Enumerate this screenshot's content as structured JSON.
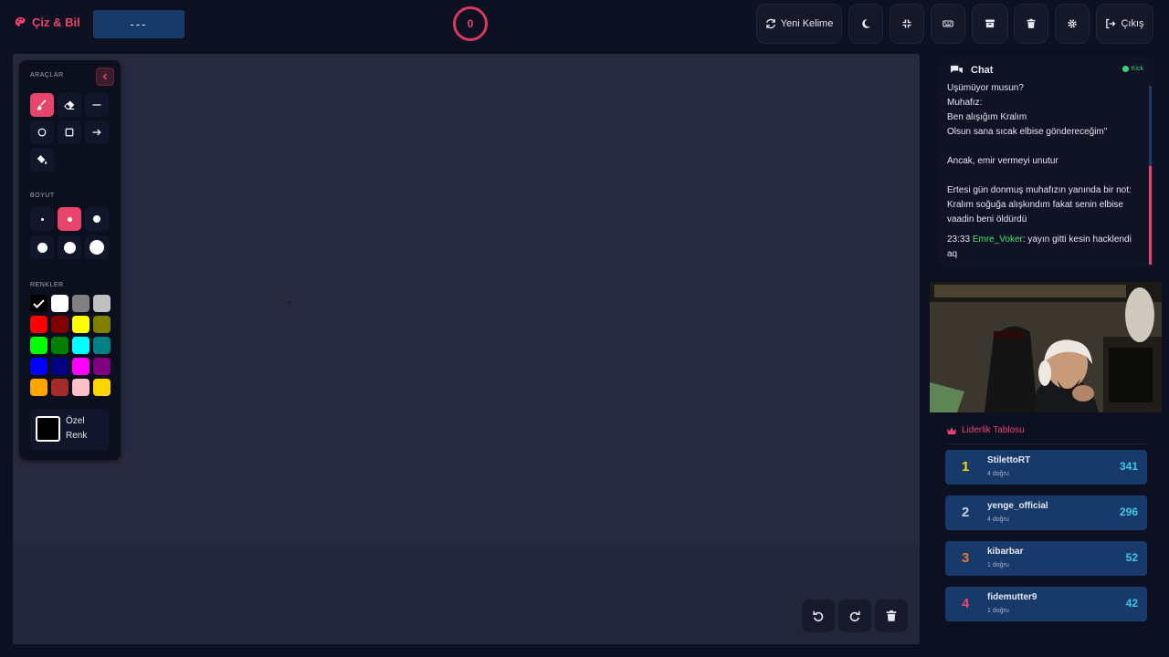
{
  "brand": {
    "name": "Çiz & Bil",
    "icon": "palette-icon",
    "color": "#e8456d"
  },
  "word_hint": "---",
  "timer": {
    "value": "0"
  },
  "toolbar": {
    "new_word_label": "Yeni Kelime",
    "exit_label": "Çıkış",
    "icons": [
      "refresh-icon",
      "moon-icon",
      "compress-icon",
      "keyboard-icon",
      "archive-icon",
      "trash-icon",
      "gear-icon",
      "logout-icon"
    ]
  },
  "tools_panel": {
    "title": "ARAÇLAR",
    "size_title": "BOYUT",
    "colors_title": "RENKLER",
    "tools": [
      "brush",
      "eraser",
      "line",
      "circle",
      "rectangle",
      "arrow",
      "fill"
    ],
    "active_tool": "brush",
    "active_size_index": 1,
    "colors": [
      "#000000",
      "#ffffff",
      "#808080",
      "#c0c0c0",
      "#ff0000",
      "#800000",
      "#ffff00",
      "#808000",
      "#00ff00",
      "#008000",
      "#00ffff",
      "#008080",
      "#0000ff",
      "#000080",
      "#ff00ff",
      "#800080",
      "#ffa500",
      "#a52a2a",
      "#ffc0cb",
      "#ffd700"
    ],
    "selected_color": "#000000",
    "custom_color_label": "Özel Renk"
  },
  "chat": {
    "title": "Chat",
    "platform": "Kick",
    "lines": [
      "Üşümüyor musun?",
      "Muhafız:",
      "Ben alışığım Kralım",
      "Olsun sana sıcak elbise göndereceğim\"",
      "",
      "Ancak, emir vermeyi unutur",
      "",
      "Ertesi gün donmuş muhafızın yanında bir not:",
      "Kralım soğuğa alışkındım fakat senin elbise",
      "vaadin beni öldürdü"
    ],
    "message": {
      "time": "23:33",
      "user": "Emre_Voker",
      "text": ": yayın gitti kesin hacklendi",
      "text_cont": "aq"
    }
  },
  "leaderboard": {
    "title": "Liderlik Tablosu",
    "rows": [
      {
        "rank": "1",
        "name": "StilettoRT",
        "sub": "4 doğru",
        "score": "341",
        "rank_color": "#f5d90a"
      },
      {
        "rank": "2",
        "name": "yenge_official",
        "sub": "4 doğru",
        "score": "296",
        "rank_color": "#c9ced8"
      },
      {
        "rank": "3",
        "name": "kibarbar",
        "sub": "1 doğru",
        "score": "52",
        "rank_color": "#e07a3c"
      },
      {
        "rank": "4",
        "name": "fidemutter9",
        "sub": "1 doğru",
        "score": "42",
        "rank_color": "#e8456d"
      }
    ]
  },
  "canvas_controls": [
    "undo-icon",
    "redo-icon",
    "trash-icon"
  ]
}
